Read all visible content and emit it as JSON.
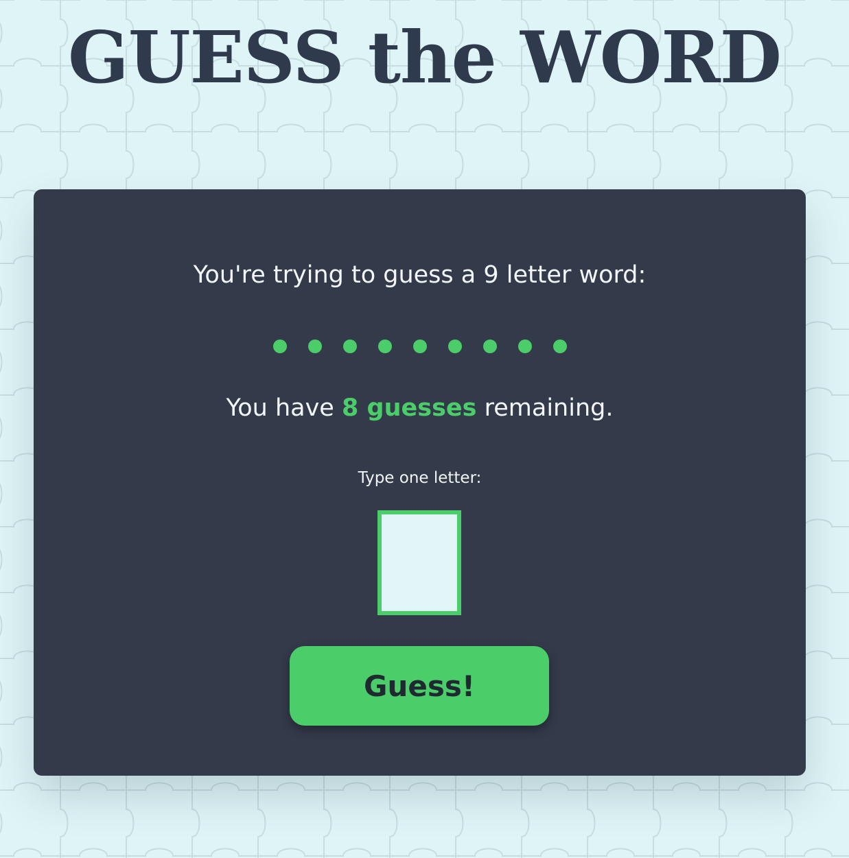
{
  "header": {
    "title": "GUESS the WORD"
  },
  "game": {
    "prompt": "You're trying to guess a 9 letter word:",
    "word_placeholder": [
      "●",
      "●",
      "●",
      "●",
      "●",
      "●",
      "●",
      "●",
      "●"
    ],
    "remaining_prefix": "You have",
    "remaining_count": "8 guesses",
    "remaining_suffix": "remaining.",
    "letter_label": "Type one letter:",
    "letter_value": "",
    "guess_label": "Guess!"
  },
  "colors": {
    "background": "#dff4f6",
    "title": "#2f3a4c",
    "card": "#333a4a",
    "accent": "#4bcd6a",
    "text_light": "#f3f6f8",
    "input_fill": "#e2f5f8",
    "pattern_line": "#c7dde0"
  },
  "icons": {
    "background": "puzzle-piece-pattern",
    "placeholder_letter": "dot"
  }
}
